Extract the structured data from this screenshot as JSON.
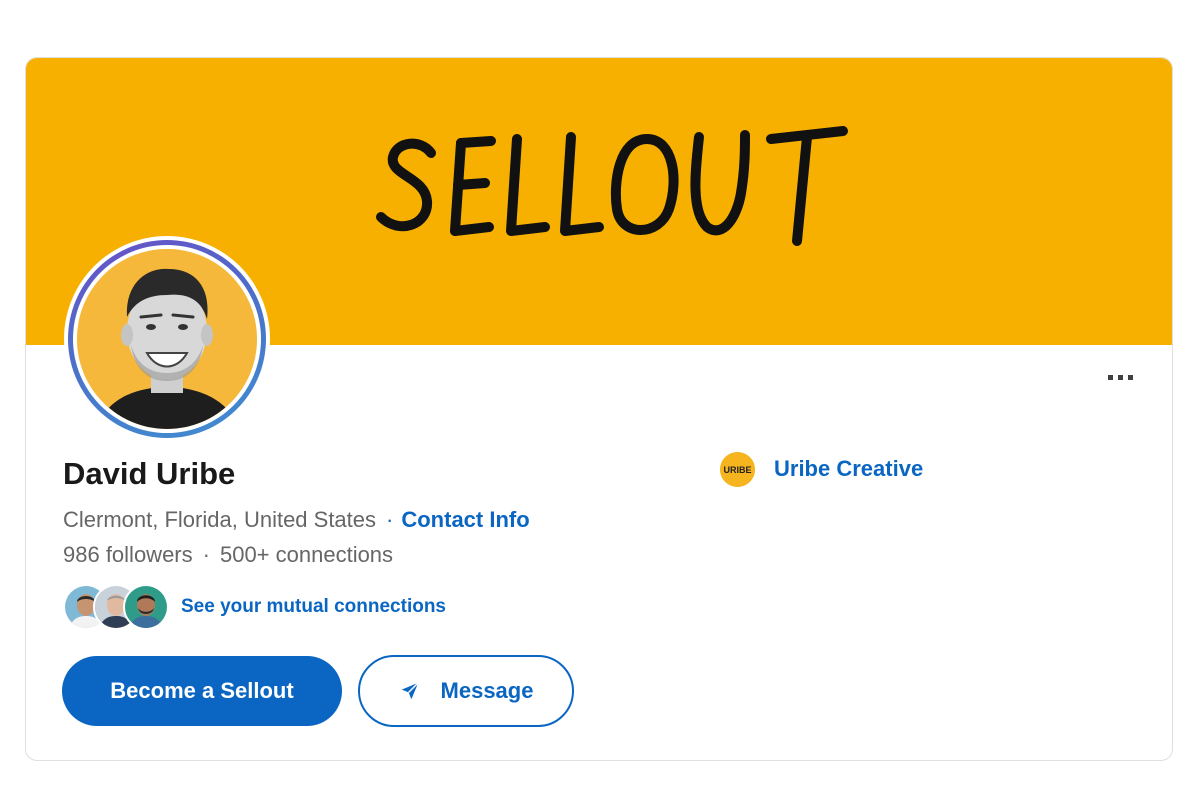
{
  "banner": {
    "text": "SELLOUT",
    "background_color": "#f8b000"
  },
  "profile": {
    "name": "David Uribe",
    "location": "Clermont, Florida, United States",
    "contact_link": "Contact Info",
    "followers": "986 followers",
    "connections": "500+ connections",
    "mutual_link": "See your mutual connections"
  },
  "actions": {
    "primary_label": "Become a Sellout",
    "message_label": "Message",
    "more_icon": "more-horizontal-icon"
  },
  "company": {
    "name": "Uribe Creative",
    "logo_text": "URIBE"
  },
  "colors": {
    "accent": "#0a66c2",
    "banner": "#f8b000",
    "text_primary": "#191919",
    "text_secondary": "#666666"
  }
}
